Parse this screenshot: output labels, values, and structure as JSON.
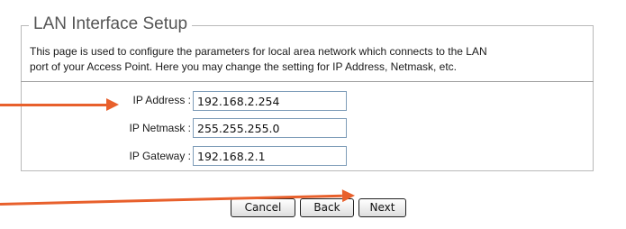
{
  "section": {
    "title": "LAN Interface Setup",
    "description_line1": "This page is used to configure the parameters for local area network which connects to the LAN",
    "description_line2": "port of your Access Point. Here you may change the setting for IP Address, Netmask, etc."
  },
  "form": {
    "ip_address": {
      "label": "IP Address :",
      "value": "192.168.2.254"
    },
    "ip_netmask": {
      "label": "IP Netmask :",
      "value": "255.255.255.0"
    },
    "ip_gateway": {
      "label": "IP Gateway :",
      "value": "192.168.2.1"
    }
  },
  "buttons": {
    "cancel": "Cancel",
    "back": "Back",
    "next": "Next"
  },
  "annotation": {
    "arrow_color": "#e8602c"
  }
}
